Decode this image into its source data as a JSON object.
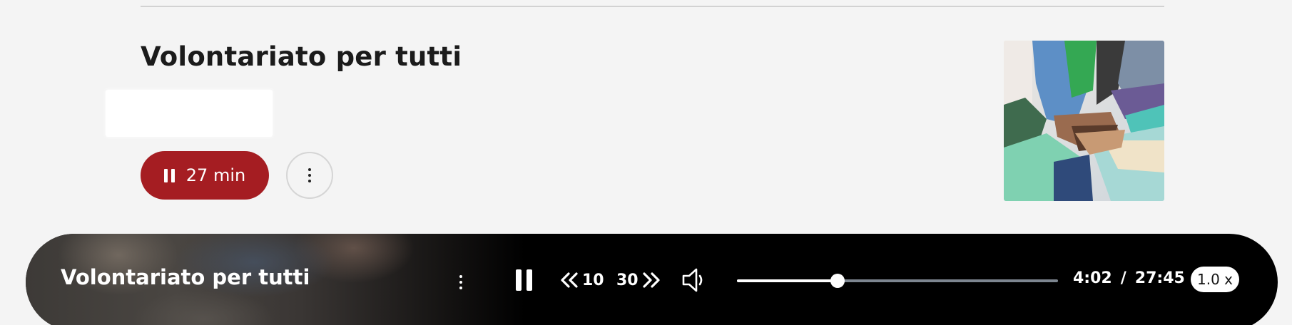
{
  "episode": {
    "title": "Volontariato per tutti",
    "play_button": {
      "duration_label": "27 min",
      "icon": "pause-icon",
      "color": "#a51d22"
    },
    "more_button_icon": "more-vertical-icon",
    "thumbnail_alt": "hands-stacked-image"
  },
  "player": {
    "title": "Volontariato per tutti",
    "more_icon": "more-vertical-icon",
    "pause_icon": "pause-icon",
    "rewind": {
      "label": "10",
      "icon": "rewind-chevrons-icon"
    },
    "forward": {
      "label": "30",
      "icon": "forward-chevrons-icon"
    },
    "volume_icon": "volume-icon",
    "progress": {
      "fraction": 0.313
    },
    "current_time": "4:02",
    "time_separator": "/",
    "total_time": "27:45",
    "speed_label": "1.0 x"
  }
}
